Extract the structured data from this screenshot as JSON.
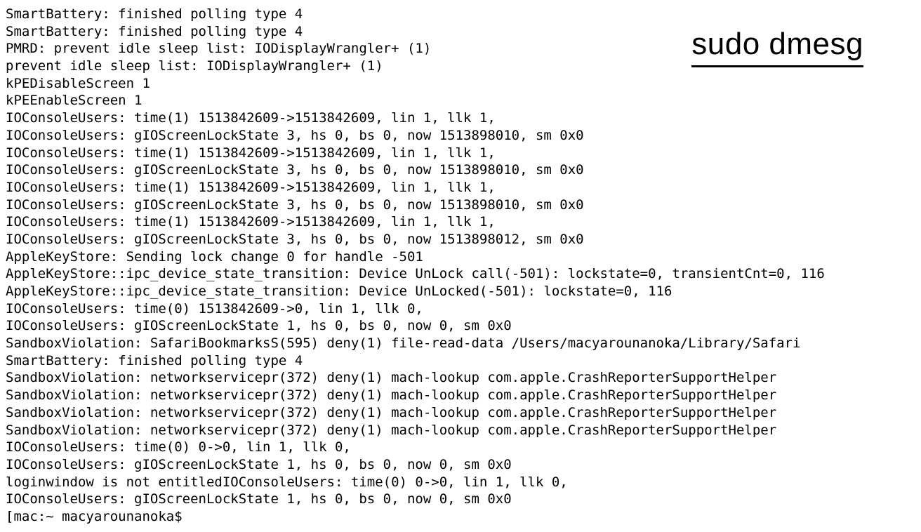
{
  "annotation_label": "sudo dmesg",
  "log_lines": [
    "SmartBattery: finished polling type 4",
    "SmartBattery: finished polling type 4",
    "PMRD: prevent idle sleep list: IODisplayWrangler+ (1)",
    "prevent idle sleep list: IODisplayWrangler+ (1)",
    "kPEDisableScreen 1",
    "kPEEnableScreen 1",
    "IOConsoleUsers: time(1) 1513842609->1513842609, lin 1, llk 1,",
    "IOConsoleUsers: gIOScreenLockState 3, hs 0, bs 0, now 1513898010, sm 0x0",
    "IOConsoleUsers: time(1) 1513842609->1513842609, lin 1, llk 1,",
    "IOConsoleUsers: gIOScreenLockState 3, hs 0, bs 0, now 1513898010, sm 0x0",
    "IOConsoleUsers: time(1) 1513842609->1513842609, lin 1, llk 1,",
    "IOConsoleUsers: gIOScreenLockState 3, hs 0, bs 0, now 1513898010, sm 0x0",
    "IOConsoleUsers: time(1) 1513842609->1513842609, lin 1, llk 1,",
    "IOConsoleUsers: gIOScreenLockState 3, hs 0, bs 0, now 1513898012, sm 0x0",
    "AppleKeyStore: Sending lock change 0 for handle -501",
    "AppleKeyStore::ipc_device_state_transition: Device UnLock call(-501): lockstate=0, transientCnt=0, 116",
    "AppleKeyStore::ipc_device_state_transition: Device UnLocked(-501): lockstate=0, 116",
    "IOConsoleUsers: time(0) 1513842609->0, lin 1, llk 0,",
    "IOConsoleUsers: gIOScreenLockState 1, hs 0, bs 0, now 0, sm 0x0",
    "SandboxViolation: SafariBookmarksS(595) deny(1) file-read-data /Users/macyarounanoka/Library/Safari",
    "SmartBattery: finished polling type 4",
    "SandboxViolation: networkservicepr(372) deny(1) mach-lookup com.apple.CrashReporterSupportHelper",
    "SandboxViolation: networkservicepr(372) deny(1) mach-lookup com.apple.CrashReporterSupportHelper",
    "SandboxViolation: networkservicepr(372) deny(1) mach-lookup com.apple.CrashReporterSupportHelper",
    "SandboxViolation: networkservicepr(372) deny(1) mach-lookup com.apple.CrashReporterSupportHelper",
    "IOConsoleUsers: time(0) 0->0, lin 1, llk 0,",
    "IOConsoleUsers: gIOScreenLockState 1, hs 0, bs 0, now 0, sm 0x0",
    "loginwindow is not entitledIOConsoleUsers: time(0) 0->0, lin 1, llk 0,",
    "IOConsoleUsers: gIOScreenLockState 1, hs 0, bs 0, now 0, sm 0x0"
  ],
  "prompt": "[mac:~ macyarounanoka$"
}
